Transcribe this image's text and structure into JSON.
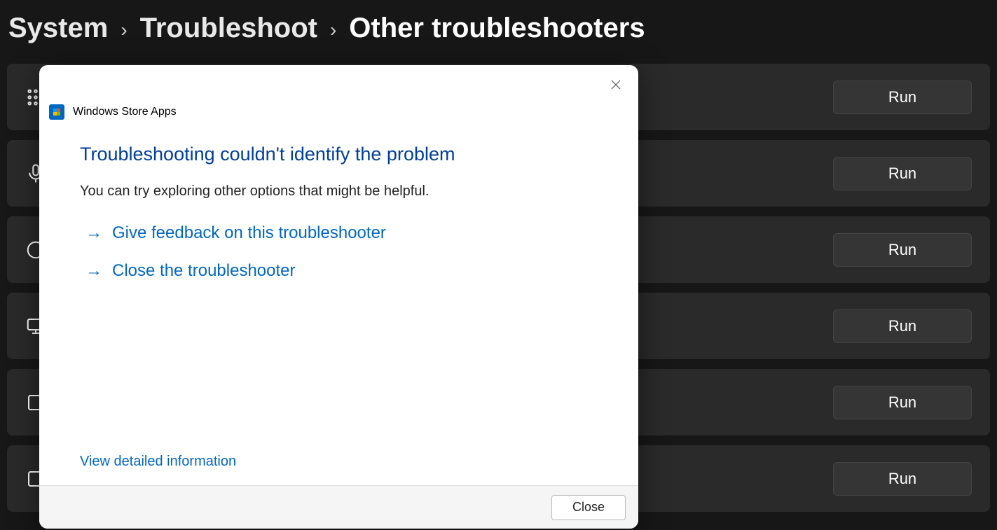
{
  "breadcrumb": {
    "items": [
      {
        "label": "System"
      },
      {
        "label": "Troubleshoot"
      },
      {
        "label": "Other troubleshooters"
      }
    ]
  },
  "troubleshooters": {
    "run_label": "Run",
    "rows": [
      {
        "icon": "keypad-icon"
      },
      {
        "icon": "mic-icon"
      },
      {
        "icon": "circle-icon"
      },
      {
        "icon": "monitor-icon"
      },
      {
        "icon": "square-icon"
      },
      {
        "icon": "square-icon"
      }
    ]
  },
  "dialog": {
    "title": "Windows Store Apps",
    "heading": "Troubleshooting couldn't identify the problem",
    "body_text": "You can try exploring other options that might be helpful.",
    "link_feedback": "Give feedback on this troubleshooter",
    "link_close": "Close the troubleshooter",
    "link_details": "View detailed information",
    "close_button": "Close"
  }
}
